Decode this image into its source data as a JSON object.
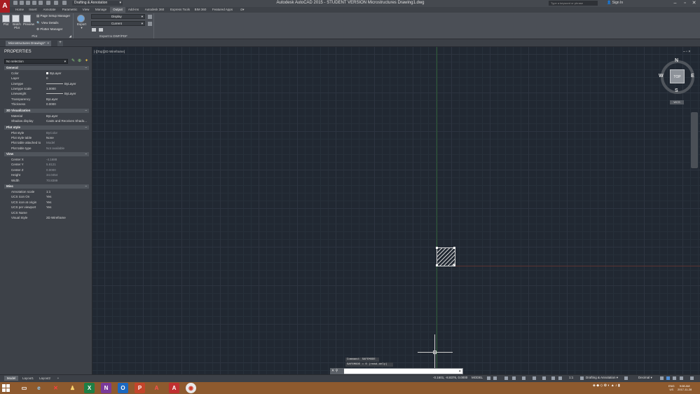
{
  "app": {
    "logo_letter": "A",
    "workspace": "Drafting & Annotation",
    "window_title": "Autodesk AutoCAD 2015 - STUDENT VERSION    Microstructures Drawing1.dwg",
    "search_placeholder": "Type a keyword or phrase",
    "sign_in": "Sign In"
  },
  "ribbon_tabs": [
    "Home",
    "Insert",
    "Annotate",
    "Parametric",
    "View",
    "Manage",
    "Output",
    "Add-ins",
    "Autodesk 360",
    "Express Tools",
    "BIM 360",
    "Featured Apps"
  ],
  "active_tab": "Output",
  "ribbon": {
    "plot": "Plot",
    "batch_plot": "Batch Plot",
    "preview": "Preview",
    "page_setup_manager": "Page Setup Manager",
    "view_details": "View Details",
    "plotter_manager": "Plotter Manager",
    "plot_panel": "Plot",
    "export": "Export",
    "export_display": "Display",
    "export_current": "Current",
    "export_panel": "Export to DWF/PDF"
  },
  "document_tab": "Microstructures Drawing1*",
  "properties": {
    "title": "PROPERTIES",
    "selection": "No selection",
    "general": {
      "header": "General",
      "rows": [
        {
          "key": "Color",
          "value": "ByLayer"
        },
        {
          "key": "Layer",
          "value": "0"
        },
        {
          "key": "Linetype",
          "value": "ByLayer"
        },
        {
          "key": "Linetype scale",
          "value": "1.0000"
        },
        {
          "key": "Lineweight",
          "value": "ByLayer"
        },
        {
          "key": "Transparency",
          "value": "ByLayer"
        },
        {
          "key": "Thickness",
          "value": "0.0000"
        }
      ]
    },
    "viz": {
      "header": "3D Visualization",
      "rows": [
        {
          "key": "Material",
          "value": "ByLayer"
        },
        {
          "key": "Shadow display",
          "value": "Casts and Receives Shado..."
        }
      ]
    },
    "plotstyle": {
      "header": "Plot style",
      "rows": [
        {
          "key": "Plot style",
          "value": "ByColor"
        },
        {
          "key": "Plot style table",
          "value": "None"
        },
        {
          "key": "Plot table attached to",
          "value": "Model"
        },
        {
          "key": "Plot table type",
          "value": "Not available"
        }
      ]
    },
    "view": {
      "header": "View",
      "rows": [
        {
          "key": "Center X",
          "value": "-4.1688"
        },
        {
          "key": "Center Y",
          "value": "5.8121"
        },
        {
          "key": "Center Z",
          "value": "0.0000"
        },
        {
          "key": "Height",
          "value": "34.0454"
        },
        {
          "key": "Width",
          "value": "70.8399"
        }
      ]
    },
    "misc": {
      "header": "Misc",
      "rows": [
        {
          "key": "Annotation scale",
          "value": "1:1"
        },
        {
          "key": "UCS icon On",
          "value": "Yes"
        },
        {
          "key": "UCS icon at origin",
          "value": "Yes"
        },
        {
          "key": "UCS per viewport",
          "value": "Yes"
        },
        {
          "key": "UCS Name",
          "value": ""
        },
        {
          "key": "Visual Style",
          "value": "2D Wireframe"
        }
      ]
    }
  },
  "viewport": {
    "label": "[-][Top][2D Wireframe]",
    "compass": {
      "n": "N",
      "s": "S",
      "e": "E",
      "w": "W",
      "top": "TOP"
    },
    "wcs": "WCS"
  },
  "command": {
    "history1": "Command: SAFEMODE",
    "history2": "SAFEMODE = 0 (read-only)",
    "placeholder": "",
    "prompt_glyph": "⚲"
  },
  "status": {
    "layout_tabs": [
      "Model",
      "Layout1",
      "Layout2"
    ],
    "coords": "-0.1601, -8.8376, 0.0000",
    "model": "MODEL",
    "scale": "1:1",
    "workspace": "Drafting & Annotation",
    "units": "Decimal"
  },
  "taskbar": {
    "lang": "ENG\nUS",
    "time": "9:08 AM",
    "date": "2017-11-28"
  },
  "colors": {
    "accent": "#a81d22",
    "canvas": "#212832",
    "taskbar": "#8e5a2e"
  }
}
